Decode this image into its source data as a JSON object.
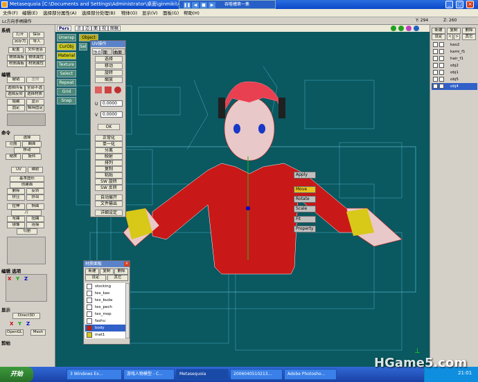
{
  "window": {
    "title": "Metasequoia [C:\\Documents and Settings\\Administrator\\桌面\\ginmiki\\小镇mqo]",
    "media_title": "吞噬槽第一集",
    "tabs": [
      "Pers",
      "点",
      "边",
      "面",
      "视",
      "图稿"
    ]
  },
  "menu": [
    "文件(F)",
    "编辑(E)",
    "选择部分属性(A)",
    "选择部分处理(B)",
    "物体(O)",
    "显示(V)",
    "面板(G)",
    "帮助(H)"
  ],
  "status": {
    "mode": "Lc方向手柄操作",
    "y": "Y: 294",
    "z": "Z: 260"
  },
  "left_panel": {
    "s1": "系统",
    "b1": [
      "打开",
      "保存",
      "另存为",
      "导入",
      "配置",
      "文件信息",
      "物体面板",
      "物体属性",
      "材质面板",
      "材质属性"
    ],
    "s2": "编辑",
    "b2": [
      "撤销",
      "重做",
      "选择所有",
      "全部不选",
      "选择反转",
      "选择材质",
      "隐藏",
      "显示",
      "固定",
      "解除固定"
    ],
    "s3": "命令",
    "b3": [
      "选择",
      "移动",
      "旋转",
      "缩放",
      "范围",
      "曲面",
      "UV",
      "映射",
      "基本图形",
      "创建面",
      "删除",
      "反转",
      "挤压",
      "挤出",
      "拉伸",
      "斜面",
      "刀",
      "切割",
      "弯曲",
      "扭曲",
      "镜像",
      "连接"
    ],
    "s4": "编辑 选项",
    "s5": "显示",
    "b5": [
      "Direct3D",
      "OpenGL",
      "Mesh"
    ],
    "s6": "剪帖"
  },
  "viewport": {
    "vbuttons": [
      "Unwrap",
      "Object",
      "CurObj",
      "Sel",
      "Material",
      "Texture",
      "Select",
      "Repeat",
      "Grid",
      "Snap"
    ]
  },
  "uv_dialog": {
    "title": "UV操作",
    "tabs": [
      "顶点",
      "面",
      "曲面"
    ],
    "buttons": [
      "选择",
      "移动",
      "旋转",
      "缩放"
    ],
    "u_label": "U",
    "u_value": "0.0000",
    "v_label": "V",
    "v_value": "0.0000",
    "ok": "OK",
    "buttons2": [
      "正常化",
      "单一化",
      "分离",
      "映射",
      "排列",
      "复制",
      "粘贴",
      "SW 旋转",
      "SW 反转",
      "自动展开",
      "文件输出",
      "详细设定"
    ]
  },
  "ctx_menu": [
    "Apply",
    "Move",
    "Rotate",
    "Scale",
    "Fit",
    "Property"
  ],
  "object_panel": {
    "buttons": [
      "新建",
      "复制",
      "删除",
      "设定",
      "<",
      ">",
      "其它"
    ],
    "objects": [
      "kao2",
      "kami_f1",
      "hair_f1",
      "obj2",
      "obj1",
      "obj5",
      "obj4"
    ]
  },
  "mat_dialog": {
    "title": "材质面板",
    "buttons": [
      "新建",
      "复制",
      "删除",
      "设定",
      "其它"
    ],
    "materials": [
      "stocking",
      "tex_kao",
      "tex_buda",
      "tex_pech",
      "tex_mop",
      "fashu",
      "body",
      "mat1"
    ]
  },
  "taskbar": {
    "start": "开始",
    "tasks": [
      "3 Windows Ex...",
      "游戏人物模型 - C...",
      "Metasequoia",
      "2006040510213...",
      "Adobe Photosho..."
    ],
    "clock": "21:01"
  },
  "watermark": "HGame5.com",
  "colors": {
    "body": "#c81818",
    "skin": "#e8c8c8",
    "yellow": "#d8c818",
    "bg": "#0a5860"
  }
}
